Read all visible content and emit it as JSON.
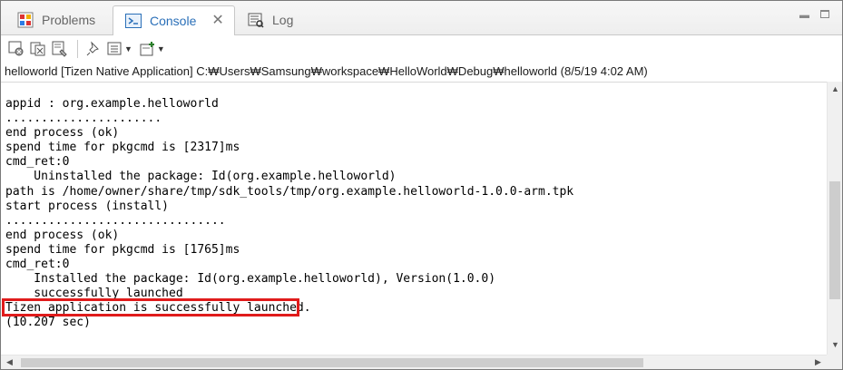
{
  "tabs": [
    {
      "label": "Problems",
      "icon": "problems-icon"
    },
    {
      "label": "Console",
      "icon": "console-icon",
      "active": true
    },
    {
      "label": "Log",
      "icon": "log-icon"
    }
  ],
  "process_title": "helloworld [Tizen Native Application] C:₩Users₩Samsung₩workspace₩HelloWorld₩Debug₩helloworld (8/5/19 4:02 AM)",
  "console_lines": [
    "appid : org.example.helloworld",
    "......................",
    "end process (ok)",
    "spend time for pkgcmd is [2317]ms",
    "cmd_ret:0",
    "    Uninstalled the package: Id(org.example.helloworld)",
    "path is /home/owner/share/tmp/sdk_tools/tmp/org.example.helloworld-1.0.0-arm.tpk",
    "start process (install)",
    "...............................",
    "end process (ok)",
    "spend time for pkgcmd is [1765]ms",
    "cmd_ret:0",
    "    Installed the package: Id(org.example.helloworld), Version(1.0.0)",
    "    successfully launched",
    "Tizen application is successfully launched.",
    "(10.207 sec)"
  ],
  "colors": {
    "highlight": "#e01b1b",
    "active_tab_text": "#2a6fb8"
  }
}
